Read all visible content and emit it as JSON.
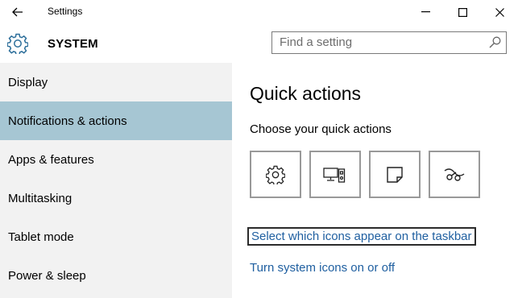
{
  "window": {
    "title": "Settings"
  },
  "header": {
    "section_title": "SYSTEM",
    "search_placeholder": "Find a setting"
  },
  "sidebar": {
    "items": [
      {
        "label": "Display",
        "selected": false
      },
      {
        "label": "Notifications & actions",
        "selected": true
      },
      {
        "label": "Apps & features",
        "selected": false
      },
      {
        "label": "Multitasking",
        "selected": false
      },
      {
        "label": "Tablet mode",
        "selected": false
      },
      {
        "label": "Power & sleep",
        "selected": false
      }
    ]
  },
  "main": {
    "title": "Quick actions",
    "subtitle": "Choose your quick actions",
    "quick_actions": [
      {
        "icon": "gear-icon"
      },
      {
        "icon": "project-icon"
      },
      {
        "icon": "note-icon"
      },
      {
        "icon": "connect-icon"
      }
    ],
    "links": {
      "taskbar_icons": "Select which icons appear on the taskbar",
      "system_icons": "Turn system icons on or off"
    }
  },
  "colors": {
    "selected_nav": "#a6c6d3",
    "sidebar_bg": "#f2f2f2",
    "link": "#1f5fa0"
  }
}
